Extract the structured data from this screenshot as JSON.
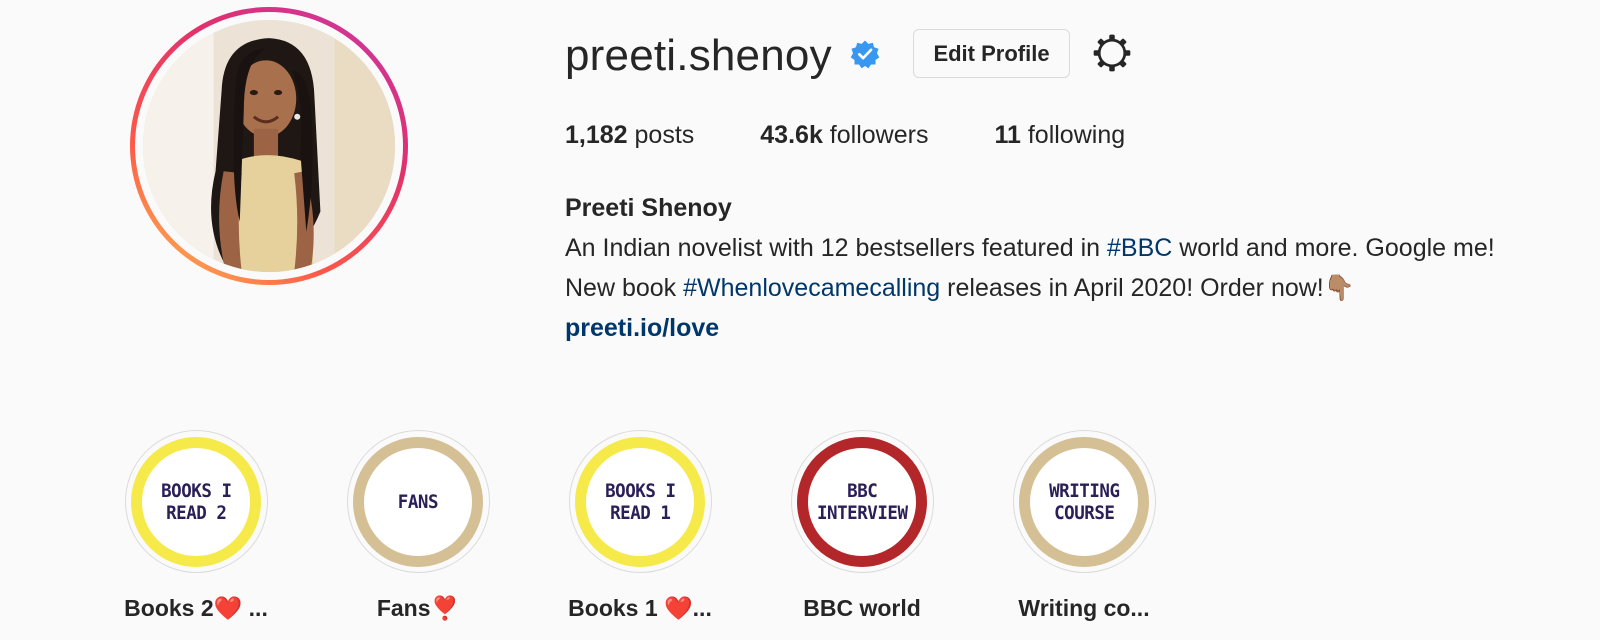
{
  "profile": {
    "username": "preeti.shenoy",
    "verified": true,
    "edit_button": "Edit Profile",
    "settings_icon": "gear-icon"
  },
  "stats": {
    "posts_count": "1,182",
    "posts_label": "posts",
    "followers_count": "43.6k",
    "followers_label": "followers",
    "following_count": "11",
    "following_label": "following"
  },
  "bio": {
    "full_name": "Preeti Shenoy",
    "line1_before": "An Indian novelist with 12 bestsellers featured in ",
    "line1_hashtag": "#BBC",
    "line1_after": " world and more. Google me!",
    "line2_before": "New book ",
    "line2_hashtag": "#Whenlovecamecalling",
    "line2_after": " releases in April 2020! Order now!👇🏽",
    "link": "preeti.io/love"
  },
  "highlights": [
    {
      "cover_text": "BOOKS I\nREAD 2",
      "label": "Books 2❤️ ...",
      "ring_color": "#f6ea4a"
    },
    {
      "cover_text": "FANS",
      "label": "Fans❣️",
      "ring_color": "#d5c096"
    },
    {
      "cover_text": "BOOKS I\nREAD 1",
      "label": "Books 1 ❤️...",
      "ring_color": "#f6ea4a"
    },
    {
      "cover_text": "BBC\nINTERVIEW",
      "label": "BBC world",
      "ring_color": "#b3272a"
    },
    {
      "cover_text": "WRITING\nCOURSE",
      "label": "Writing co...",
      "ring_color": "#d5c096"
    }
  ],
  "colors": {
    "link": "#00376b",
    "verified_badge": "#3897f0",
    "story_ring_gradient": [
      "#c837ab",
      "#e1306c",
      "#fd5949",
      "#fdcb52"
    ]
  }
}
